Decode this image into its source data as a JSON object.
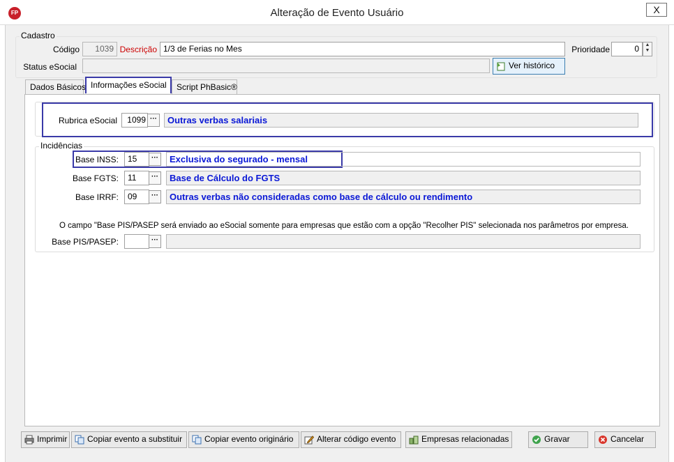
{
  "window": {
    "title": "Alteração de Evento Usuário",
    "close_label": "X",
    "app_icon_text": "FP"
  },
  "cadastro": {
    "group_label": "Cadastro",
    "codigo_label": "Código",
    "codigo_value": "1039",
    "descricao_label": "Descrição",
    "descricao_value": "1/3 de Ferias no Mes",
    "prioridade_label": "Prioridade",
    "prioridade_value": "0",
    "status_label": "Status eSocial",
    "status_value": "",
    "ver_historico_label": "Ver histórico"
  },
  "tabs": [
    {
      "label": "Dados Básicos"
    },
    {
      "label": "Informações eSocial"
    },
    {
      "label": "Script PhBasic®"
    }
  ],
  "rubrica": {
    "label": "Rubrica eSocial",
    "code": "1099",
    "description": "Outras verbas salariais"
  },
  "incidencias": {
    "group_label": "Incidências",
    "inss": {
      "label": "Base INSS:",
      "code": "15",
      "description": "Exclusiva do segurado - mensal"
    },
    "fgts": {
      "label": "Base FGTS:",
      "code": "11",
      "description": "Base de Cálculo do FGTS"
    },
    "irrf": {
      "label": "Base IRRF:",
      "code": "09",
      "description": "Outras verbas não consideradas como base de cálculo ou rendimento"
    },
    "pis_note": "O campo \"Base PIS/PASEP será enviado ao eSocial somente para empresas que estão com a opção \"Recolher PIS\" selecionada nos parâmetros por empresa.",
    "pis": {
      "label": "Base PIS/PASEP:",
      "code": "",
      "description": ""
    }
  },
  "buttons": {
    "imprimir": "Imprimir",
    "copiar_substituir": "Copiar evento a substituir",
    "copiar_originario": "Copiar evento originário",
    "alterar_codigo": "Alterar código evento",
    "empresas": "Empresas relacionadas",
    "gravar": "Gravar",
    "cancelar": "Cancelar"
  },
  "colors": {
    "accent_blue": "#0a18d6",
    "highlight": "#3a3aa8",
    "descricao_red": "#cc0000"
  }
}
